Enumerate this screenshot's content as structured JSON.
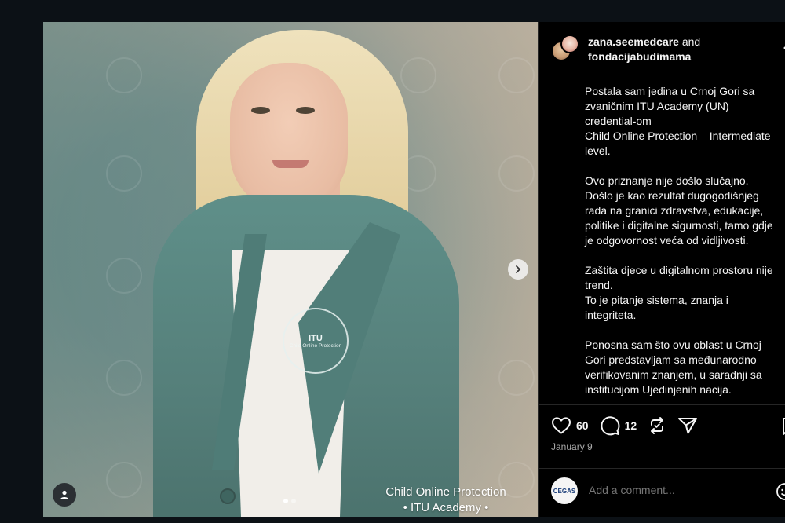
{
  "post": {
    "collab_user1": "zana.seemedcare",
    "collab_join": "and",
    "collab_user2": "fondacijabudimama",
    "paragraphs": [
      "Postala sam jedina u Crnoj Gori sa\nzvaničnim ITU Academy (UN)\ncredential-om\nChild Online Protection – Intermediate\nlevel.",
      "Ovo priznanje nije došlo slučajno.\nDošlo je kao rezultat dugogodišnjeg\nrada na granici zdravstva, edukacije,\npolitike i digitalne sigurnosti, tamo gdje\nje odgovornost veća od vidljivosti.",
      "Zaštita djece u digitalnom prostoru nije\ntrend.\nTo je pitanje sistema, znanja i\nintegriteta.",
      "Ponosna sam što ovu oblast u Crnoj\nGori predstavljam sa međunarodno\nverifikovanim znanjem, u saradnji sa\ninstitucijom Ujedinjenih nacija."
    ],
    "likes": "60",
    "comments": "12",
    "date": "January 9",
    "comment_placeholder": "Add a comment...",
    "commenter_avatar_text": "CEGAS"
  },
  "photo": {
    "caption_line1": "Child Online Protection",
    "caption_line2": "• ITU Academy •",
    "badge_title": "ITU",
    "badge_sub": "Child Online Protection"
  },
  "icons": {
    "heart": "heart-icon",
    "comment": "comment-icon",
    "repost": "repost-icon",
    "share": "share-icon",
    "save": "bookmark-icon",
    "next": "chevron-right-icon",
    "tag": "user-tag-icon",
    "emoji": "emoji-icon"
  },
  "colors": {
    "background": "#0c1116",
    "panel": "#000000",
    "text": "#f5f5f5",
    "muted": "#a8a8a8"
  }
}
